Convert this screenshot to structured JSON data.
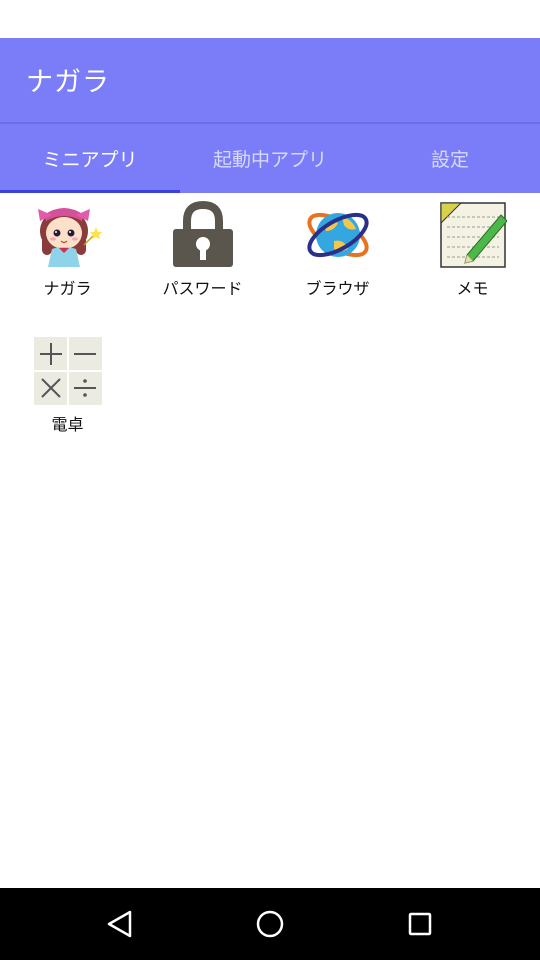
{
  "app": {
    "title": "ナガラ"
  },
  "tabs": [
    {
      "label": "ミニアプリ",
      "active": true
    },
    {
      "label": "起動中アプリ",
      "active": false
    },
    {
      "label": "設定",
      "active": false
    }
  ],
  "apps": [
    {
      "label": "ナガラ",
      "icon": "character-icon"
    },
    {
      "label": "パスワード",
      "icon": "padlock-icon"
    },
    {
      "label": "ブラウザ",
      "icon": "globe-icon"
    },
    {
      "label": "メモ",
      "icon": "notepad-pencil-icon"
    },
    {
      "label": "電卓",
      "icon": "calculator-icon"
    }
  ],
  "nav": {
    "back": "back-icon",
    "home": "home-icon",
    "recents": "recents-icon"
  },
  "colors": {
    "primary": "#7b7df8",
    "indicator": "#3b3fe0",
    "nav_bar": "#000000"
  }
}
